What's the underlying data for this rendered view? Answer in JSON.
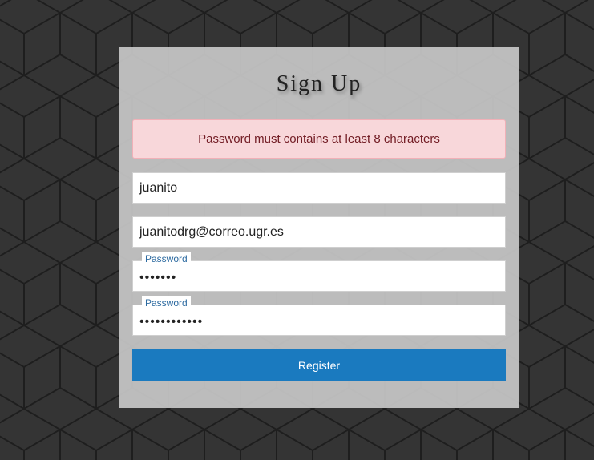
{
  "form": {
    "title": "Sign Up",
    "alert": "Password must contains at least 8 characters",
    "username_value": "juanito",
    "email_value": "juanitodrg@correo.ugr.es",
    "password_label": "Password",
    "password_value": "•••••••",
    "confirm_label": "Password",
    "confirm_value": "••••••••••••",
    "register_label": "Register"
  },
  "colors": {
    "background": "#333333",
    "alert_bg": "#f8d7da",
    "alert_text": "#721c24",
    "button": "#1a7abf",
    "label": "#2c6aa0"
  }
}
